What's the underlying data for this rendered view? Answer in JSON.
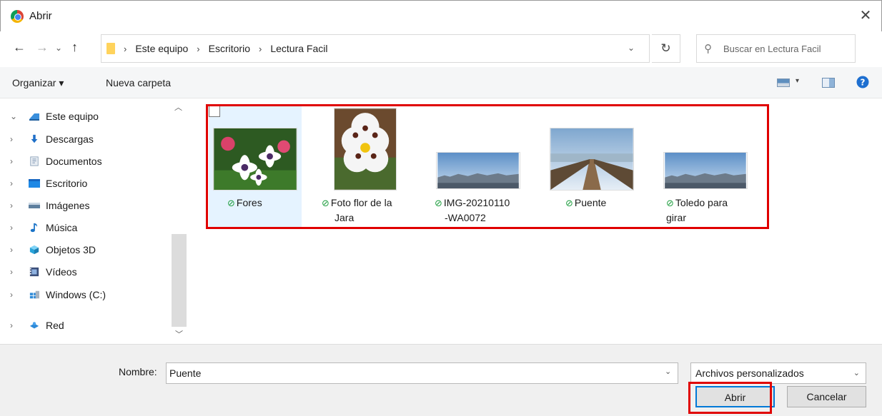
{
  "window": {
    "title": "Abrir",
    "close": "✕"
  },
  "nav": {
    "back": "←",
    "forward": "→",
    "recent": "⌄",
    "up": "↑",
    "breadcrumbs": [
      "Este equipo",
      "Escritorio",
      "Lectura Facil"
    ],
    "separator": "›",
    "refresh": "↻",
    "search_placeholder": "Buscar en Lectura Facil"
  },
  "toolbar": {
    "organize": "Organizar ▾",
    "new_folder": "Nueva carpeta",
    "view_dropdown": "▾"
  },
  "sidebar": {
    "items": [
      {
        "label": "Este equipo",
        "chev": "⌄",
        "icon": "computer-icon"
      },
      {
        "label": "Descargas",
        "chev": "›",
        "icon": "download-icon"
      },
      {
        "label": "Documentos",
        "chev": "›",
        "icon": "documents-icon"
      },
      {
        "label": "Escritorio",
        "chev": "›",
        "icon": "desktop-icon"
      },
      {
        "label": "Imágenes",
        "chev": "›",
        "icon": "images-icon"
      },
      {
        "label": "Música",
        "chev": "›",
        "icon": "music-icon"
      },
      {
        "label": "Objetos 3D",
        "chev": "›",
        "icon": "objects3d-icon"
      },
      {
        "label": "Vídeos",
        "chev": "›",
        "icon": "videos-icon"
      },
      {
        "label": "Windows  (C:)",
        "chev": "›",
        "icon": "drive-icon"
      },
      {
        "label": "Red",
        "chev": "›",
        "icon": "network-icon"
      }
    ]
  },
  "files": [
    {
      "line1": "Fores",
      "line2": "",
      "selected": true,
      "thumb": "flowers"
    },
    {
      "line1": "Foto flor de la",
      "line2": "Jara",
      "selected": false,
      "thumb": "jara"
    },
    {
      "line1": "IMG-20210110",
      "line2": "-WA0072",
      "selected": false,
      "thumb": "city"
    },
    {
      "line1": "Puente",
      "line2": "",
      "selected": false,
      "thumb": "bridge"
    },
    {
      "line1": "Toledo para",
      "line2": "girar",
      "selected": false,
      "thumb": "city"
    }
  ],
  "sync_mark": "✓",
  "bottom": {
    "name_label": "Nombre:",
    "name_value": "Puente",
    "filter": "Archivos personalizados",
    "open": "Abrir",
    "cancel": "Cancelar",
    "dropdown": "⌄"
  },
  "colors": {
    "highlight": "#e00000",
    "selection": "#e5f3ff",
    "accent": "#0078d7"
  }
}
